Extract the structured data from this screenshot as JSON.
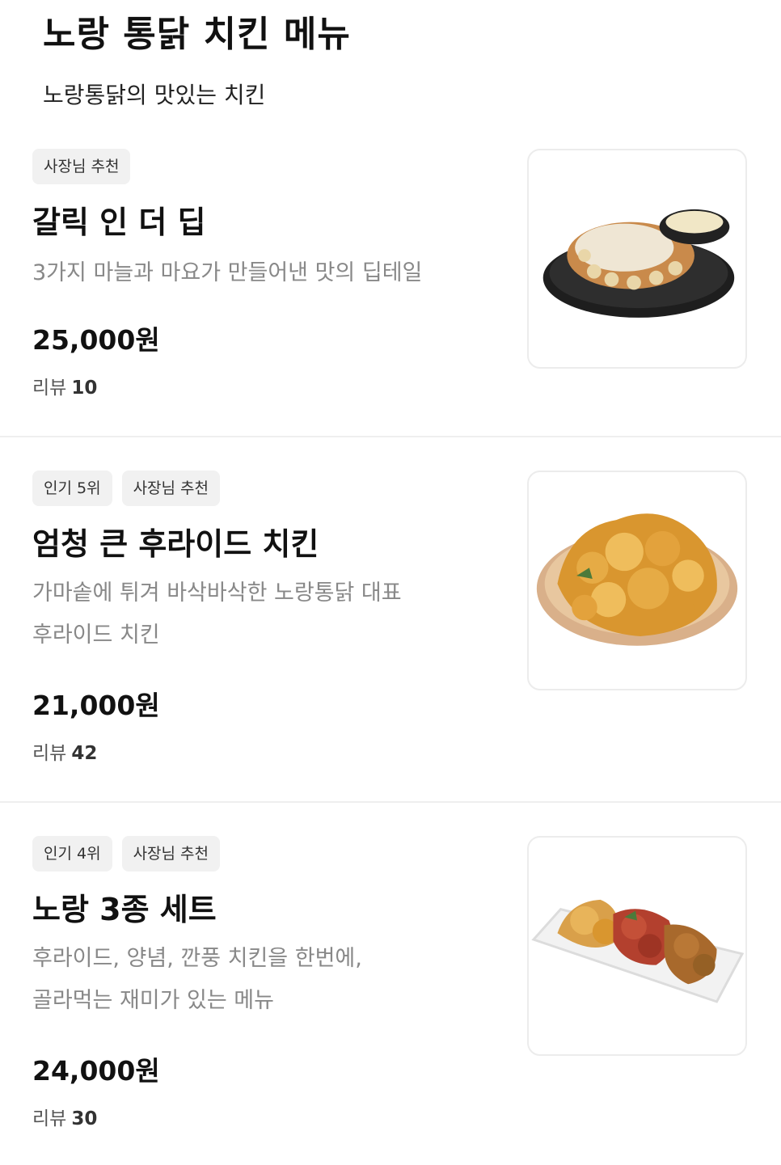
{
  "header": {
    "title": "노랑 통닭 치킨 메뉴",
    "subtitle": "노랑통닭의 맛있는 치킨"
  },
  "menu": [
    {
      "tags": [
        "사장님 추천"
      ],
      "name": "갈릭 인 더 딥",
      "description": [
        "3가지 마늘과 마요가 만들어낸 맛의 딥테일"
      ],
      "price": "25,000원",
      "review_label": "리뷰",
      "review_count": "10",
      "image_icon": "garlic-chicken-image"
    },
    {
      "tags": [
        "인기 5위",
        "사장님 추천"
      ],
      "name": "엄청 큰 후라이드 치킨",
      "description": [
        "가마솥에 튀겨 바삭바삭한 노랑통닭 대표",
        "후라이드 치킨"
      ],
      "price": "21,000원",
      "review_label": "리뷰",
      "review_count": "42",
      "image_icon": "fried-chicken-image"
    },
    {
      "tags": [
        "인기 4위",
        "사장님 추천"
      ],
      "name": "노랑 3종 세트",
      "description": [
        "후라이드, 양념, 깐풍 치킨을 한번에,",
        "골라먹는 재미가 있는 메뉴"
      ],
      "price": "24,000원",
      "review_label": "리뷰",
      "review_count": "30",
      "image_icon": "three-chicken-set-image"
    }
  ],
  "colors": {
    "tag_bg": "#f1f1f1",
    "desc_text": "#888888",
    "divider": "#efefef"
  }
}
